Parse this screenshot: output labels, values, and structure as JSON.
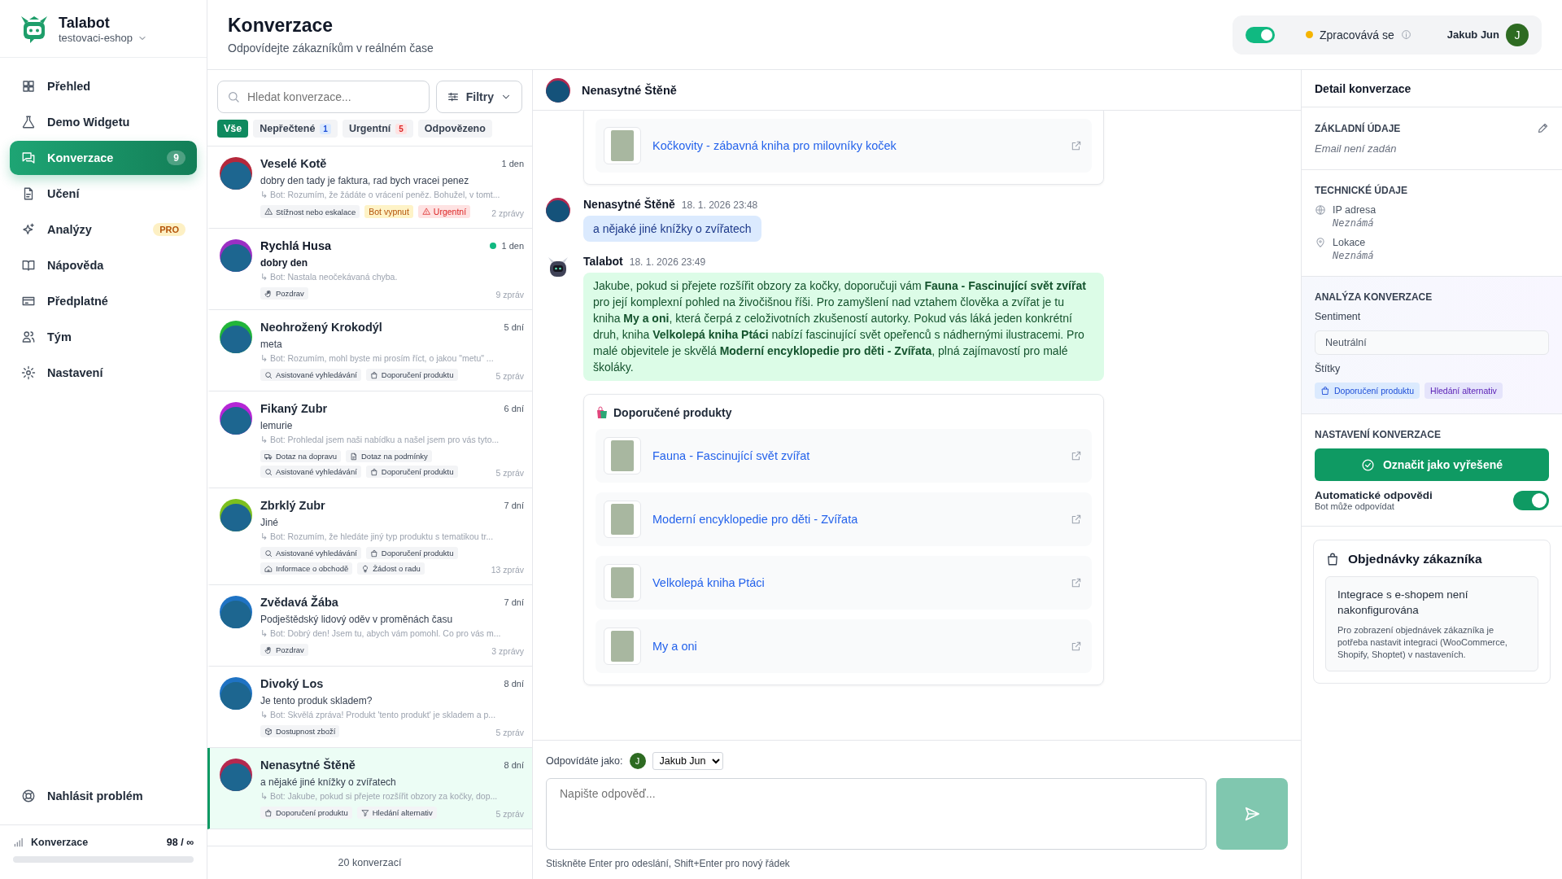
{
  "brand": {
    "name": "Talabot",
    "workspace": "testovaci-eshop"
  },
  "nav": [
    {
      "label": "Přehled",
      "kind": "grid",
      "selected": false
    },
    {
      "label": "Demo Widgetu",
      "kind": "flask",
      "selected": false
    },
    {
      "label": "Konverzace",
      "kind": "chat",
      "selected": true,
      "badge": {
        "text": "9",
        "kind": "count"
      }
    },
    {
      "label": "Učení",
      "kind": "document",
      "selected": false
    },
    {
      "label": "Analýzy",
      "kind": "sparkle",
      "selected": false,
      "badge": {
        "text": "PRO",
        "kind": "pro"
      }
    },
    {
      "label": "Nápověda",
      "kind": "book",
      "selected": false
    },
    {
      "label": "Předplatné",
      "kind": "card",
      "selected": false
    },
    {
      "label": "Tým",
      "kind": "people",
      "selected": false
    },
    {
      "label": "Nastavení",
      "kind": "gear",
      "selected": false
    }
  ],
  "report": {
    "label": "Nahlásit problém"
  },
  "usage": {
    "label": "Konverzace",
    "count": "98 / ∞"
  },
  "header": {
    "title": "Konverzace",
    "subtitle": "Odpovídejte zákazníkům v reálném čase",
    "live_toggle": {
      "on": true
    },
    "status": "Zpracovává se",
    "user": {
      "name": "Jakub Jun",
      "initial": "J"
    }
  },
  "list": {
    "search_placeholder": "Hledat konverzace...",
    "filter_button": "Filtry",
    "chips": [
      {
        "label": "Vše",
        "selected": true
      },
      {
        "label": "Nepřečtené",
        "count": "1",
        "kind": "info",
        "selected": false
      },
      {
        "label": "Urgentní",
        "count": "5",
        "kind": "danger",
        "selected": false
      },
      {
        "label": "Odpovězeno",
        "selected": false
      }
    ],
    "footer": "20 konverzací"
  },
  "conversations": [
    {
      "name": "Veselé Kotě",
      "time": "1 den",
      "preview": "dobry den tady je faktura, rad bych vracei penez",
      "bot": "↳ Bot: Rozumím, že žádáte o vrácení peněz. Bohužel, v tomt...",
      "tags": [
        {
          "label": "Stížnost nebo eskalace",
          "kind": "escalation"
        },
        {
          "label": "Bot vypnut",
          "kind": "bot-off"
        },
        {
          "label": "Urgentní",
          "kind": "urgent"
        }
      ],
      "count": "2 zprávy",
      "color": "#b5283b",
      "unread": false,
      "selected": false
    },
    {
      "name": "Rychlá Husa",
      "time": "1 den",
      "preview": "dobry den",
      "bot": "↳ Bot: Nastala neočekávaná chyba.",
      "tags": [
        {
          "label": "Pozdrav",
          "kind": "greeting"
        }
      ],
      "count": "9 zpráv",
      "color": "#9b2fc4",
      "unread": true,
      "selected": false
    },
    {
      "name": "Neohrožený Krokodýl",
      "time": "5 dní",
      "preview": "meta",
      "bot": "↳ Bot: Rozumím, mohl byste mi prosím říct, o jakou \"metu\" ...",
      "tags": [
        {
          "label": "Asistované vyhledávání",
          "kind": "search"
        },
        {
          "label": "Doporučení produktu",
          "kind": "product"
        }
      ],
      "count": "5 zpráv",
      "color": "#22b53a",
      "unread": false,
      "selected": false
    },
    {
      "name": "Fikaný Zubr",
      "time": "6 dní",
      "preview": "lemurie",
      "bot": "↳ Bot: Prohledal jsem naši nabídku a našel jsem pro vás tyto...",
      "tags": [
        {
          "label": "Dotaz na dopravu",
          "kind": "shipping"
        },
        {
          "label": "Dotaz na podmínky",
          "kind": "terms"
        },
        {
          "label": "Asistované vyhledávání",
          "kind": "search"
        },
        {
          "label": "Doporučení produktu",
          "kind": "product"
        }
      ],
      "count": "5 zpráv",
      "color": "#b526d6",
      "unread": false,
      "selected": false
    },
    {
      "name": "Zbrklý Zubr",
      "time": "7 dní",
      "preview": "Jiné",
      "bot": "↳ Bot: Rozumím, že hledáte jiný typ produktu s tematikou tr...",
      "tags": [
        {
          "label": "Asistované vyhledávání",
          "kind": "search"
        },
        {
          "label": "Doporučení produktu",
          "kind": "product"
        },
        {
          "label": "Informace o obchodě",
          "kind": "store-info"
        },
        {
          "label": "Žádost o radu",
          "kind": "advice"
        }
      ],
      "count": "13 zpráv",
      "color": "#7cc01e",
      "unread": false,
      "selected": false
    },
    {
      "name": "Zvědavá Žába",
      "time": "7 dní",
      "preview": "Podještědský lidový oděv v proměnách času",
      "bot": "↳ Bot: Dobrý den! Jsem tu, abych vám pomohl. Co pro vás m...",
      "tags": [
        {
          "label": "Pozdrav",
          "kind": "greeting"
        }
      ],
      "count": "3 zprávy",
      "color": "#1f73c4",
      "unread": false,
      "selected": false
    },
    {
      "name": "Divoký Los",
      "time": "8 dní",
      "preview": "Je tento produk skladem?",
      "bot": "↳ Bot: Skvělá zpráva! Produkt 'tento produkt' je skladem a p...",
      "tags": [
        {
          "label": "Dostupnost zboží",
          "kind": "stock"
        }
      ],
      "count": "5 zpráv",
      "color": "#1f73c4",
      "unread": false,
      "selected": false
    },
    {
      "name": "Nenasytné Štěně",
      "time": "8 dní",
      "preview": "a nějaké jiné knížky o zvířatech",
      "bot": "↳ Bot: Jakube, pokud si přejete rozšířit obzory za kočky, dop...",
      "tags": [
        {
          "label": "Doporučení produktu",
          "kind": "product"
        },
        {
          "label": "Hledání alternativ",
          "kind": "alternatives"
        }
      ],
      "count": "5 zpráv",
      "color": "#b5284f",
      "unread": false,
      "selected": true
    }
  ],
  "chat": {
    "name": "Nenasytné Štěně",
    "messages": [
      {
        "kind": "products",
        "items": [
          {
            "title": "Kočkovity - zábavná kniha pro milovníky koček"
          }
        ]
      },
      {
        "kind": "user",
        "author": "Nenasytné Štěně",
        "time": "18. 1. 2026 23:48",
        "text": "a nějaké jiné knížky o zvířatech"
      },
      {
        "kind": "bot",
        "author": "Talabot",
        "time": "18. 1. 2026 23:49",
        "text": "Jakube, pokud si přejete rozšířit obzory za kočky, doporučuji vám **Fauna - Fascinující svět zvířat** pro její komplexní pohled na živočišnou říši. Pro zamyšlení nad vztahem člověka a zvířat je tu kniha **My a oni**, která čerpá z celoživotních zkušeností autorky. Pokud vás láká jeden konkrétní druh, kniha **Velkolepá kniha Ptáci** nabízí fascinující svět opeřenců s nádhernými ilustracemi. Pro malé objevitele je skvělá **Moderní encyklopedie pro děti - Zvířata**, plná zajímavostí pro malé školáky."
      },
      {
        "kind": "products",
        "title": "Doporučené produkty",
        "items": [
          {
            "title": "Fauna - Fascinující svět zvířat"
          },
          {
            "title": "Moderní encyklopedie pro děti - Zvířata"
          },
          {
            "title": "Velkolepá kniha Ptáci"
          },
          {
            "title": "My a oni"
          }
        ]
      }
    ]
  },
  "composer": {
    "reply_as": "Odpovídáte jako:",
    "agent_initial": "J",
    "agent": "Jakub Jun",
    "placeholder": "Napište odpověď...",
    "hint": "Stiskněte Enter pro odeslání, Shift+Enter pro nový řádek"
  },
  "detail": {
    "title": "Detail konverzace",
    "basic": {
      "heading": "ZÁKLADNÍ ÚDAJE",
      "email": "Email není zadán"
    },
    "technical": {
      "heading": "TECHNICKÉ ÚDAJE",
      "fields": [
        {
          "label": "IP adresa",
          "value": "Neznámá",
          "kind": "globe"
        },
        {
          "label": "Lokace",
          "value": "Neznámá",
          "kind": "pin"
        }
      ]
    },
    "analysis": {
      "heading": "ANALÝZA KONVERZACE",
      "sentiment_label": "Sentiment",
      "sentiment": "Neutrální",
      "tags_label": "Štítky",
      "tags": [
        {
          "label": "Doporučení produktu",
          "kind": "product"
        },
        {
          "label": "Hledání alternativ",
          "kind": "plain"
        }
      ]
    },
    "settings": {
      "heading": "NASTAVENÍ KONVERZACE",
      "resolve_button": "Označit jako vyřešené",
      "auto_reply": {
        "label": "Automatické odpovědi",
        "sublabel": "Bot může odpovídat",
        "on": true
      }
    },
    "orders": {
      "title": "Objednávky zákazníka",
      "notice_title": "Integrace s e-shopem není nakonfigurována",
      "notice_text": "Pro zobrazení objednávek zákazníka je potřeba nastavit integraci (WooCommerce, Shopify, Shoptet) v nastaveních."
    }
  }
}
